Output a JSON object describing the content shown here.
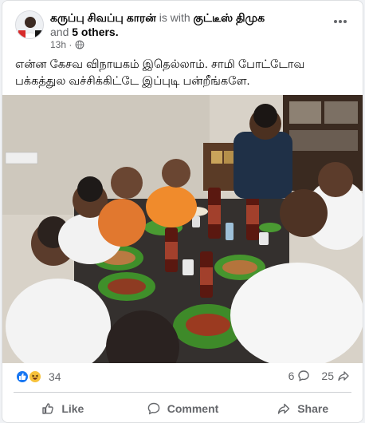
{
  "post": {
    "author": "கருப்பு சிவப்பு காரன்",
    "with_text": "is with",
    "tagged": "குட்டீஸ் திமுக",
    "and_text": "and",
    "others": "5 others.",
    "time": "13h ·",
    "privacy_icon": "globe-icon",
    "text": "என்ன கேசவ விநாயகம் இதெல்லாம். சாமி போட்டோவ பக்கத்துல வச்சிக்கிட்டே இப்புடி பன்றீங்களே."
  },
  "engagement": {
    "reaction_icons": [
      "like-icon",
      "haha-icon"
    ],
    "reaction_count": "34",
    "comment_count": "6",
    "share_count": "25"
  },
  "actions": {
    "like": "Like",
    "comment": "Comment",
    "share": "Share"
  },
  "colors": {
    "brand_blue": "#1877f2",
    "muted": "#65676b"
  }
}
